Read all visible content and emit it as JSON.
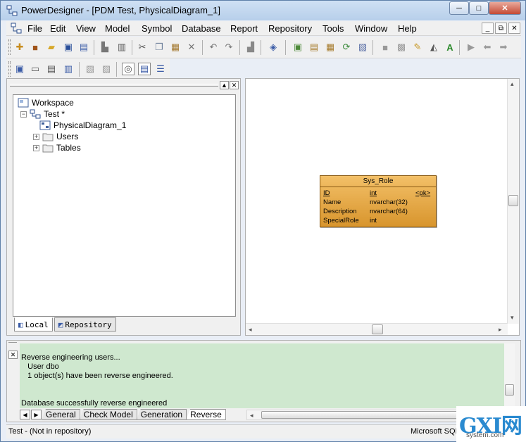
{
  "window": {
    "title": "PowerDesigner - [PDM Test, PhysicalDiagram_1]",
    "buttons": [
      "─",
      "□",
      "✕"
    ]
  },
  "menubar": {
    "items": [
      "File",
      "Edit",
      "View",
      "Model",
      "Symbol",
      "Database",
      "Report",
      "Repository",
      "Tools",
      "Window",
      "Help"
    ],
    "mdi_buttons": [
      "_",
      "⧉",
      "✕"
    ]
  },
  "browser": {
    "tree": {
      "root": "Workspace",
      "model": "Test *",
      "children": [
        "PhysicalDiagram_1",
        "Users",
        "Tables"
      ]
    },
    "tabs": [
      "Local",
      "Repository"
    ]
  },
  "diagram": {
    "table": {
      "name": "Sys_Role",
      "columns": [
        {
          "name": "ID",
          "type": "int",
          "key": "<pk>"
        },
        {
          "name": "Name",
          "type": "nvarchar(32)",
          "key": ""
        },
        {
          "name": "Description",
          "type": "nvarchar(64)",
          "key": ""
        },
        {
          "name": "SpecialRole",
          "type": "int",
          "key": ""
        }
      ]
    }
  },
  "output": {
    "lines": [
      "Reverse engineering users...",
      "   User dbo",
      "   1 object(s) have been reverse engineered.",
      "",
      "Database successfully reverse engineered"
    ],
    "tabs": [
      "General",
      "Check Model",
      "Generation",
      "Reverse"
    ]
  },
  "statusbar": {
    "left": "Test - (Not in repository)",
    "right": "Microsoft SQL"
  },
  "watermark": {
    "logo": "GXI网",
    "sub": "system.com"
  },
  "colors": {
    "table_fill": "#e0a040",
    "output_bg": "#cfe8cf",
    "title_bg": "#c2d7ee"
  }
}
